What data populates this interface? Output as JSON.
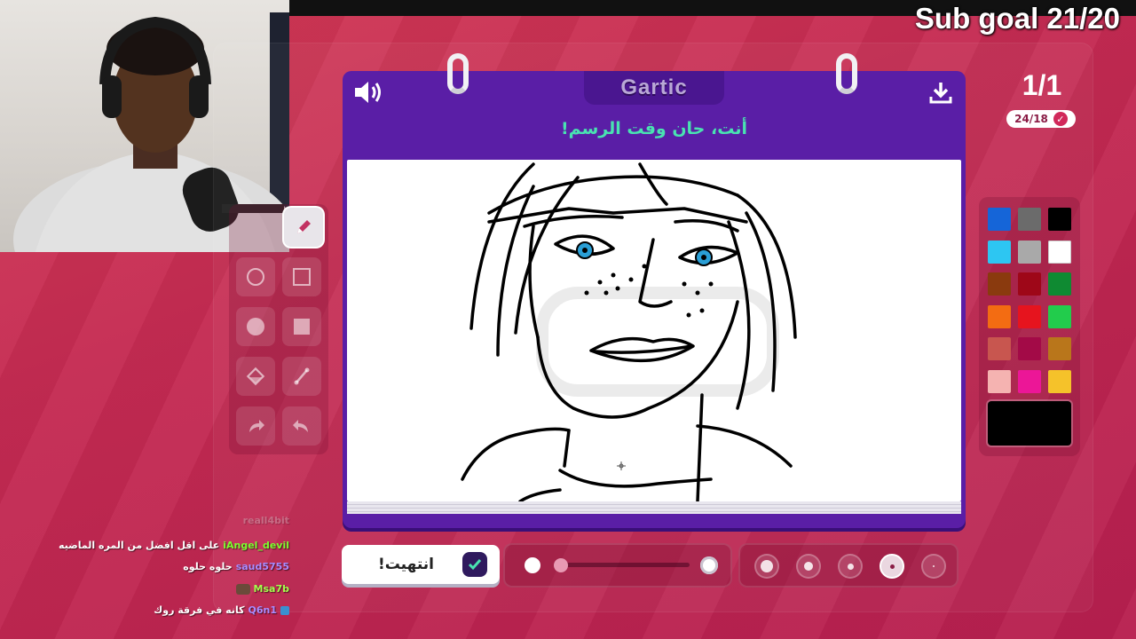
{
  "overlay": {
    "sub_goal": "Sub goal 21/20"
  },
  "game": {
    "logo": "Gartic",
    "prompt": "أنت، حان وقت الرسم!",
    "round": "1/1",
    "players": "24/18",
    "done_button": "انتهيت!",
    "colors": {
      "card": "#5a1ea6",
      "prompt": "#49e3b1",
      "background": "#c42a52"
    },
    "icons": {
      "sound": "speaker-icon",
      "download": "download-icon"
    },
    "palette": [
      "#1565d8",
      "#6b6b6b",
      "#000000",
      "#2dc6f2",
      "#a9a9a9",
      "#ffffff",
      "#8a3a0e",
      "#9e0718",
      "#0f8a32",
      "#f36c12",
      "#e6141e",
      "#22cc4c",
      "#c8564f",
      "#a30a47",
      "#b9761b",
      "#f5b3b1",
      "#ec1697",
      "#f5c22a"
    ],
    "selected_color": "#000000",
    "opacity_percent": 100,
    "brush_size_selected_index": 3
  },
  "chat": [
    {
      "user": "reall4bit",
      "message": "",
      "user_color": "#bbbbbb",
      "faded": true
    },
    {
      "user": "iAngel_devil",
      "message": "على اقل افضل من المره الماضيه",
      "user_color": "#7cff2e"
    },
    {
      "user": "saud5755",
      "message": "حلوه حلوه",
      "user_color": "#a98bff"
    },
    {
      "user": "Msa7b",
      "message": "",
      "user_color": "#a6ff4d",
      "emote": true
    },
    {
      "user": "Q6n1",
      "message": "كانه في فرقة روك",
      "user_color": "#a98bff",
      "badge": true
    }
  ]
}
